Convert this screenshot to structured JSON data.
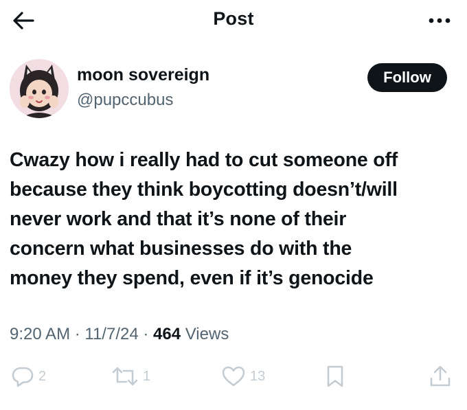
{
  "header": {
    "title": "Post",
    "back_icon": "arrow-left-icon",
    "more_icon": "more-horizontal-icon"
  },
  "author": {
    "display_name": "moon sovereign",
    "handle": "@pupccubus",
    "follow_label": "Follow"
  },
  "post": {
    "text": "Cwazy how i really had to cut someone off\nbecause they think boycotting doesn’t/will\nnever work and that it’s none of their\nconcern what businesses do with the\nmoney they spend, even if it’s genocide",
    "time": "9:20 AM",
    "separator": " · ",
    "date": "11/7/24",
    "views_count": "464",
    "views_label": "Views"
  },
  "actions": {
    "replies": "2",
    "reposts": "1",
    "likes": "13"
  },
  "colors": {
    "text": "#0f1419",
    "secondary": "#536471",
    "action_icons": "#c4ccd3",
    "follow_bg": "#0f1419"
  }
}
